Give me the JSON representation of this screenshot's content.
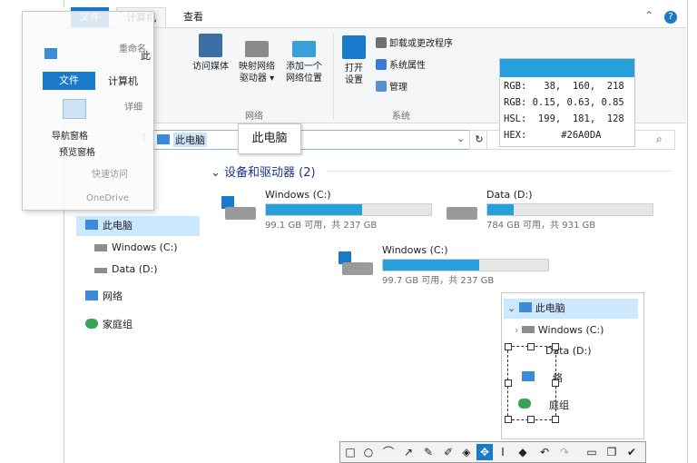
{
  "colors": {
    "accent": "#26a0da",
    "selection": "#cce8ff",
    "file_tab": "#1979ca"
  },
  "ribbon": {
    "tabs": [
      "文件",
      "计算机",
      "查看"
    ],
    "buttons": {
      "access_media": "访问媒体",
      "map_drive_1": "映射网络",
      "map_drive_2": "驱动器 ▾",
      "add_location_1": "添加一个",
      "add_location_2": "网络位置",
      "open_settings_1": "打开",
      "open_settings_2": "设置"
    },
    "small": {
      "uninstall": "卸载或更改程序",
      "system_props": "系统属性",
      "manage": "管理"
    },
    "groups": {
      "network": "网络",
      "system": "系统"
    },
    "help": "?",
    "collapse": "⌃"
  },
  "address": {
    "path": "此电脑",
    "dropdown": "⌄",
    "refresh": "↻",
    "search_icon": "⌕",
    "up": "↑"
  },
  "tooltip": "此电脑",
  "nav": {
    "this_pc": "此电脑",
    "windows_c": "Windows (C:)",
    "data_d": "Data (D:)",
    "network": "网络",
    "homegroup": "家庭组"
  },
  "content": {
    "group_header": "⌄ 设备和驱动器 (2)",
    "drives": [
      {
        "name": "Windows (C:)",
        "size": "99.1 GB 可用，共 237 GB",
        "used_fraction": 0.58
      },
      {
        "name": "Data (D:)",
        "size": "784 GB 可用，共 931 GB",
        "used_fraction": 0.16
      },
      {
        "name": "Windows (C:)",
        "size": "99.7 GB 可用，共 237 GB",
        "used_fraction": 0.58
      }
    ]
  },
  "overlay": {
    "file_tab": "文件",
    "computer_tab": "计算机",
    "rename": "重命名",
    "details": "详细",
    "nav_pane": "导航窗格",
    "preview_pane": "预览窗格",
    "quick_access": "快速访问",
    "onedrive": "OneDrive",
    "this_prefix": "此"
  },
  "color_picker": {
    "rgb_int": "RGB:   38,  160,  218",
    "rgb_float": "RGB: 0.15, 0.63, 0.85",
    "hsl": "HSL:  199,  181,  128",
    "hex": "HEX:      #26A0DA"
  },
  "magnifier": {
    "this_pc": "此电脑",
    "windows_c": "Windows (C:)",
    "data_d": "Data (D:)",
    "net_suffix": "络",
    "home_suffix": "庭组"
  },
  "toolbar": [
    "□",
    "○",
    "⌒",
    "↗",
    "✎",
    "✐",
    "◈",
    "✥",
    "I",
    "◆",
    "↶",
    "↷",
    "▭",
    "❐",
    "✔"
  ]
}
